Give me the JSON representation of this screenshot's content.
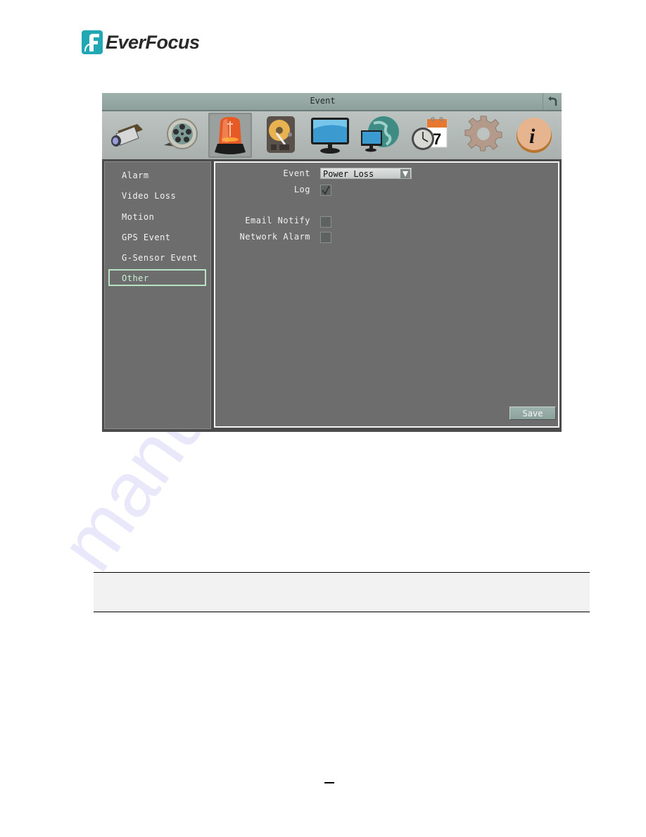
{
  "brand": {
    "name": "EverFocus",
    "mark_color": "#22a8b5"
  },
  "window": {
    "title": "Event",
    "back_icon": "back-arrow-icon"
  },
  "toolbar": {
    "icons": [
      {
        "name": "camera-icon",
        "label": "Camera"
      },
      {
        "name": "film-reel-icon",
        "label": "Record"
      },
      {
        "name": "alarm-siren-icon",
        "label": "Event",
        "active": true
      },
      {
        "name": "hard-disk-icon",
        "label": "Disk"
      },
      {
        "name": "monitor-icon",
        "label": "Display"
      },
      {
        "name": "network-globe-icon",
        "label": "Network"
      },
      {
        "name": "clock-calendar-icon",
        "label": "Schedule"
      },
      {
        "name": "gear-icon",
        "label": "System"
      },
      {
        "name": "info-icon",
        "label": "Info"
      }
    ],
    "calendar_day": "7",
    "info_glyph": "i"
  },
  "sidebar": {
    "items": [
      {
        "label": "Alarm"
      },
      {
        "label": "Video Loss"
      },
      {
        "label": "Motion"
      },
      {
        "label": "GPS Event"
      },
      {
        "label": "G-Sensor Event"
      },
      {
        "label": "Other",
        "selected": true
      }
    ]
  },
  "form": {
    "event_label": "Event",
    "event_value": "Power Loss",
    "log_label": "Log",
    "log_checked": true,
    "email_label": "Email Notify",
    "email_checked": false,
    "network_alarm_label": "Network Alarm",
    "network_alarm_checked": false,
    "save_label": "Save"
  },
  "watermark": "manualslib.com",
  "page_number": "—"
}
